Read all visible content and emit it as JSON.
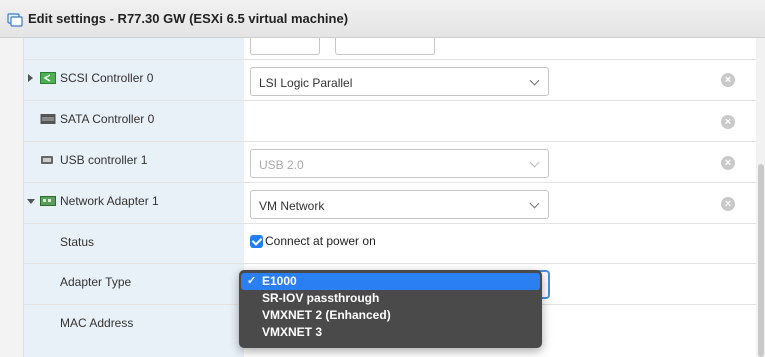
{
  "window": {
    "title": "Edit settings - R77.30 GW (ESXi 6.5 virtual machine)",
    "icon": "vm-icon"
  },
  "rows": [
    {
      "label": "SCSI Controller 0",
      "value": "LSI Logic Parallel",
      "icon": "scsi-controller-icon",
      "expander": "collapsed"
    },
    {
      "label": "SATA Controller 0",
      "value": "",
      "icon": "sata-controller-icon"
    },
    {
      "label": "USB controller 1",
      "value": "USB 2.0",
      "icon": "usb-icon",
      "disabled": true
    },
    {
      "label": "Network Adapter 1",
      "value": "VM Network",
      "icon": "network-adapter-icon",
      "expander": "expanded"
    },
    {
      "label": "Status",
      "checkbox_label": "Connect at power on",
      "checked": true
    },
    {
      "label": "Adapter Type"
    },
    {
      "label": "MAC Address"
    }
  ],
  "adapter_type_dropdown": {
    "options": [
      "E1000",
      "SR-IOV passthrough",
      "VMXNET 2 (Enhanced)",
      "VMXNET 3"
    ],
    "selected": "E1000",
    "check_glyph": "✓"
  },
  "remove_glyph": "×",
  "colors": {
    "label_column_bg": "#e8f1f8",
    "selection_blue": "#2a7ff3",
    "menu_bg": "#4a4a4a"
  }
}
